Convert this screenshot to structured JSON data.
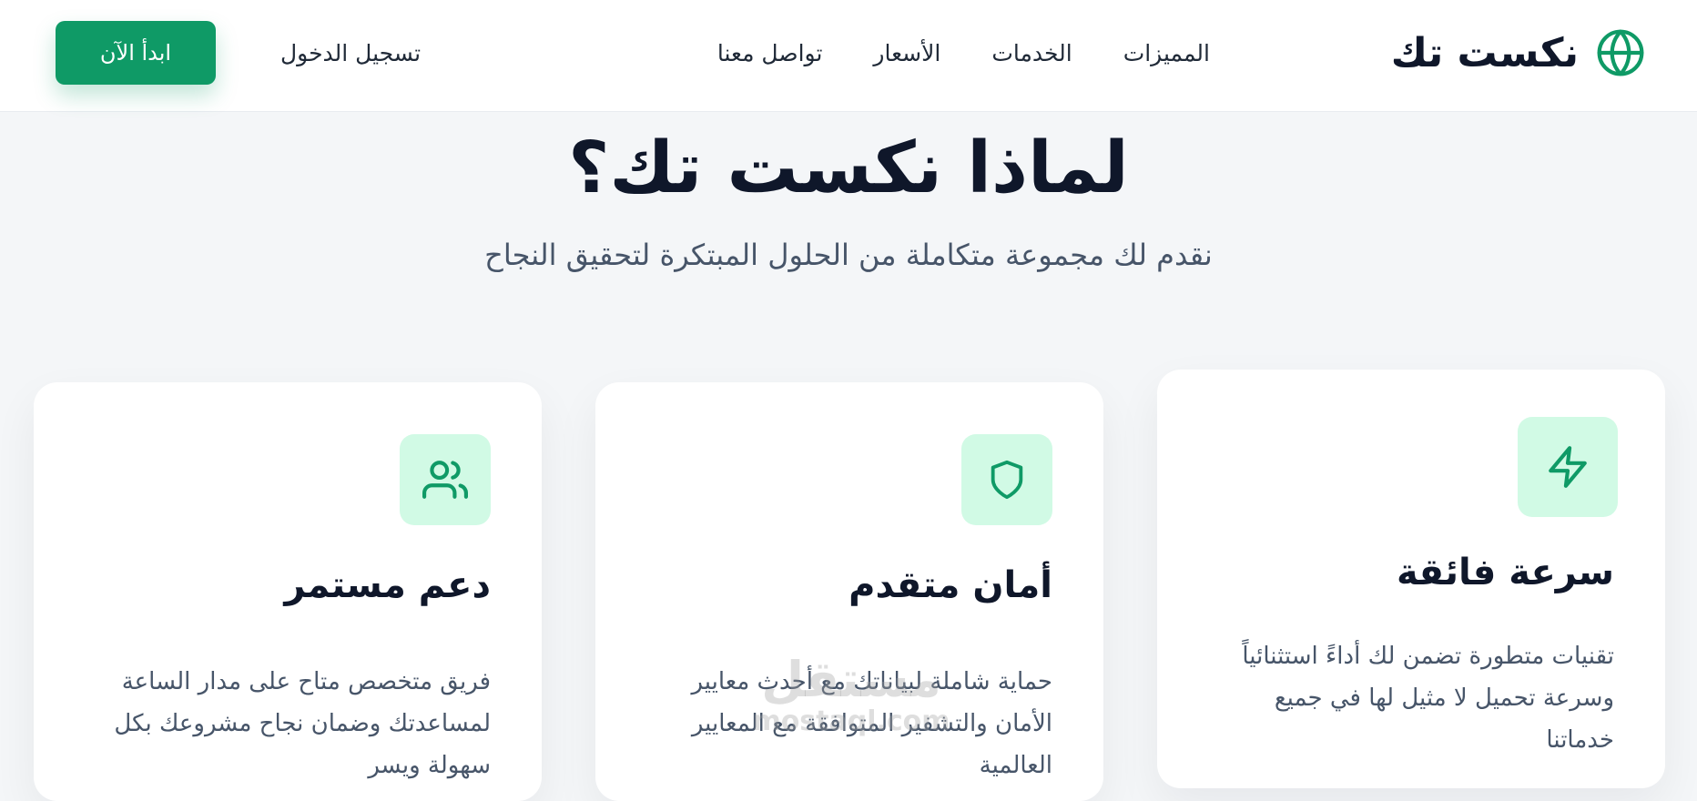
{
  "header": {
    "brand": {
      "name": "نكست تك",
      "icon": "globe-icon"
    },
    "nav": [
      {
        "label": "المميزات"
      },
      {
        "label": "الخدمات"
      },
      {
        "label": "الأسعار"
      },
      {
        "label": "تواصل معنا"
      }
    ],
    "login_label": "تسجيل الدخول",
    "cta_label": "ابدأ الآن"
  },
  "section": {
    "title": "لماذا نكست تك؟",
    "subtitle": "نقدم لك مجموعة متكاملة من الحلول المبتكرة لتحقيق النجاح"
  },
  "features": [
    {
      "icon": "lightning-icon",
      "title": "سرعة فائقة",
      "description": "تقنيات متطورة تضمن لك أداءً استثنائياً وسرعة تحميل لا مثيل لها في جميع خدماتنا"
    },
    {
      "icon": "shield-icon",
      "title": "أمان متقدم",
      "description": "حماية شاملة لبياناتك مع أحدث معايير الأمان والتشفير المتوافقة مع المعايير العالمية"
    },
    {
      "icon": "users-icon",
      "title": "دعم مستمر",
      "description": "فريق متخصص متاح على مدار الساعة لمساعدتك وضمان نجاح مشروعك بكل سهولة ويسر"
    }
  ],
  "watermark": {
    "arabic": "مستقل",
    "latin": "mostaql.com"
  },
  "colors": {
    "accent": "#0f9a66",
    "icon_bg": "#d1fae5",
    "page_bg": "#f4f6f8",
    "text_dark": "#0f172a",
    "text_muted": "#475569"
  }
}
